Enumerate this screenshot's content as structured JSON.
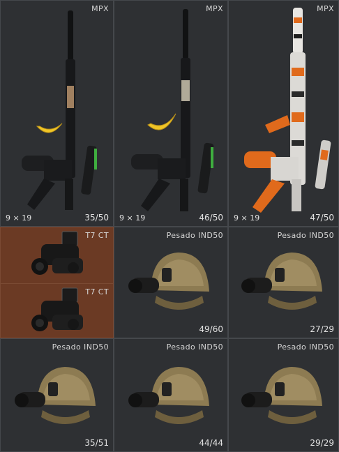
{
  "inventory": {
    "weapons": [
      {
        "name": "MPX",
        "caliber": "9 × 19",
        "count": "35/50",
        "skin": "black",
        "attachment": "banana",
        "rail_accent": "#a08060"
      },
      {
        "name": "MPX",
        "caliber": "9 × 19",
        "count": "46/50",
        "skin": "black",
        "attachment": "banana",
        "rail_accent": "#b0aa98"
      },
      {
        "name": "MPX",
        "caliber": "9 × 19",
        "count": "47/50",
        "skin": "orange-white-camo",
        "attachment": "none",
        "rail_accent": "#e06a1c"
      }
    ],
    "nvg_stack": [
      {
        "name": "T7 CT"
      },
      {
        "name": "T7 CT"
      }
    ],
    "helmets": [
      {
        "name": "Pesado IND50",
        "count": "49/60"
      },
      {
        "name": "Pesado IND50",
        "count": "27/29"
      },
      {
        "name": "Pesado IND50",
        "count": "35/51"
      },
      {
        "name": "Pesado IND50",
        "count": "44/44"
      },
      {
        "name": "Pesado IND50",
        "count": "29/29"
      }
    ]
  },
  "colors": {
    "cell_bg": "#2e3033",
    "selected_bg": "#6b3a24",
    "helmet_tan": "#8d7b52",
    "rifle_black": "#151617",
    "camo_orange": "#e06a1c"
  }
}
